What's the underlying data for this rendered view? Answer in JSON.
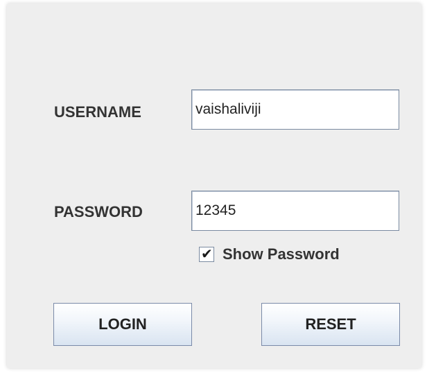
{
  "form": {
    "username_label": "USERNAME",
    "username_value": "vaishaliviji",
    "password_label": "PASSWORD",
    "password_value": "12345",
    "show_password_label": "Show Password",
    "show_password_checked": true,
    "login_label": "LOGIN",
    "reset_label": "RESET"
  }
}
